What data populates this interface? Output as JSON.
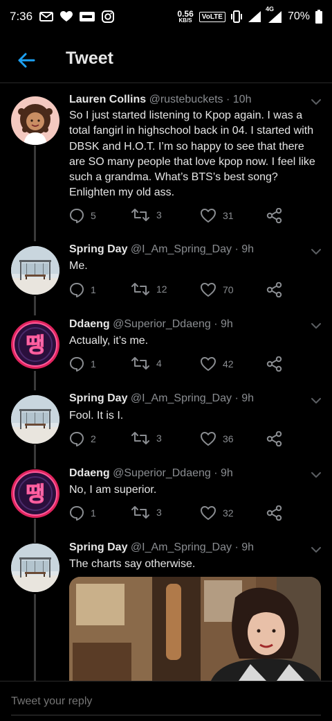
{
  "status_bar": {
    "time": "7:36",
    "speed_value": "0.56",
    "speed_unit": "KB/S",
    "volte": "VoLTE",
    "network": "4G",
    "battery": "70%"
  },
  "header": {
    "title": "Tweet"
  },
  "tweets": [
    {
      "name": "Lauren Collins",
      "handle": "@rustebuckets",
      "time": "10h",
      "text": "So I just started listening to Kpop again. I was a total fangirl in highschool back in 04. I started with DBSK and H.O.T. I’m so happy to see that there are SO many people that love kpop now. I feel like such a grandma. What’s BTS’s best song? Enlighten my old ass.",
      "replies": "5",
      "retweets": "3",
      "likes": "31"
    },
    {
      "name": "Spring Day",
      "handle": "@I_Am_Spring_Day",
      "time": "9h",
      "text": "Me.",
      "replies": "1",
      "retweets": "12",
      "likes": "70"
    },
    {
      "name": "Ddaeng",
      "handle": "@Superior_Ddaeng",
      "time": "9h",
      "text": "Actually, it’s me.",
      "replies": "1",
      "retweets": "4",
      "likes": "42"
    },
    {
      "name": "Spring Day",
      "handle": "@I_Am_Spring_Day",
      "time": "9h",
      "text": "Fool. It is I.",
      "replies": "2",
      "retweets": "3",
      "likes": "36"
    },
    {
      "name": "Ddaeng",
      "handle": "@Superior_Ddaeng",
      "time": "9h",
      "text": "No, I am superior.",
      "replies": "1",
      "retweets": "3",
      "likes": "32"
    },
    {
      "name": "Spring Day",
      "handle": "@I_Am_Spring_Day",
      "time": "9h",
      "text": "The charts say otherwise."
    }
  ],
  "ddaeng_avatar_text": "땡",
  "reply": {
    "placeholder": "Tweet your reply"
  },
  "colors": {
    "accent": "#1da1f2",
    "background": "#000000",
    "muted": "#8a8d91",
    "divider": "#2a2a2a"
  },
  "icons": [
    "arrow-left-icon",
    "chevron-down-icon",
    "reply-icon",
    "retweet-icon",
    "heart-icon",
    "share-icon"
  ]
}
